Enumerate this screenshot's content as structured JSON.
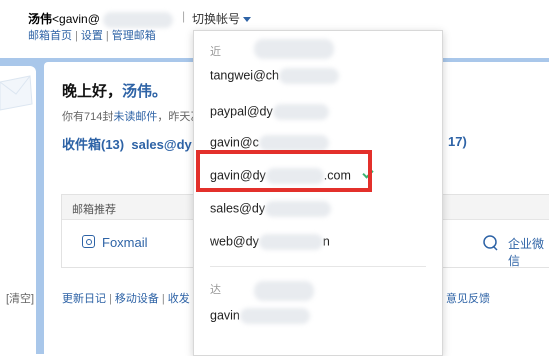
{
  "header": {
    "user_name": "汤伟",
    "user_email_prefix": "<gavin@",
    "separator": "|",
    "switch_account": "切换帐号",
    "links": [
      "邮箱首页",
      "设置",
      "管理邮箱"
    ],
    "link_separator": "|"
  },
  "sidebar": {
    "clear_label": "[清空]"
  },
  "main": {
    "greeting": "晚上好，",
    "greeting_name": "汤伟。",
    "unread_prefix": "你有714封",
    "unread_link": "未读邮件",
    "unread_suffix": "，昨天乙",
    "inbox": "收件箱(13)",
    "sales_prefix": "sales@dy",
    "folder_tail": "17)",
    "recommend_title": "邮箱推荐",
    "foxmail": "Foxmail",
    "wework": "企业微信"
  },
  "footer": {
    "links": [
      "更新日记",
      "移动设备",
      "收发"
    ],
    "separator": "|",
    "feedback": "意见反馈"
  },
  "dropdown": {
    "section1": "近",
    "section2": "达",
    "accounts": [
      {
        "text": "tangwei@ch",
        "selected": false
      },
      {
        "text": "paypal@dy",
        "selected": false
      },
      {
        "text": "gavin@c",
        "selected": false
      },
      {
        "text_prefix": "gavin@dy",
        "text_suffix": ".com",
        "selected": true
      },
      {
        "text": "sales@dy",
        "selected": false
      },
      {
        "text_prefix": "web@dy",
        "text_suffix": "n",
        "selected": false
      },
      {
        "text": "gavin",
        "selected": false
      }
    ],
    "highlight_color": "#e3302b",
    "check_color": "#3cb371"
  },
  "colors": {
    "link": "#2e63a6",
    "band": "#a9c7ea"
  }
}
